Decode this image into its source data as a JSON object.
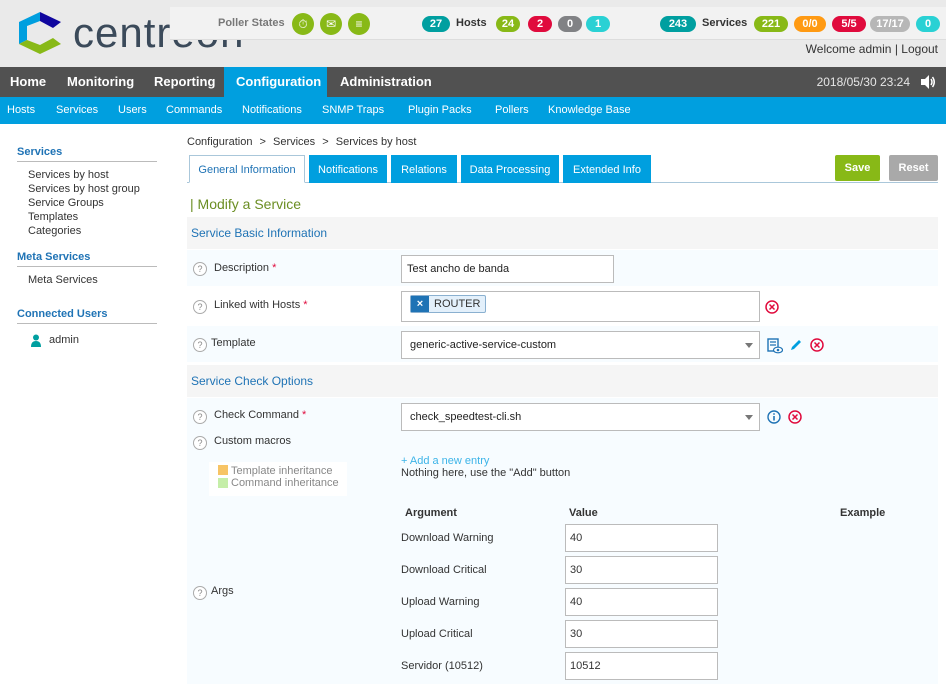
{
  "brand": {
    "name": "centreon"
  },
  "status": {
    "poller_states_label": "Poller States",
    "hosts": {
      "total": "27",
      "label": "Hosts",
      "up": "24",
      "down": "2",
      "unreachable": "0",
      "pending": "1"
    },
    "services": {
      "total": "243",
      "label": "Services",
      "ok": "221",
      "warning": "0/0",
      "critical": "5/5",
      "unknown": "17/17",
      "pending": "0"
    }
  },
  "user": {
    "welcome": "Welcome admin",
    "logout": "Logout",
    "separator": "|"
  },
  "mainnav": [
    "Home",
    "Monitoring",
    "Reporting",
    "Configuration",
    "Administration"
  ],
  "clock": "2018/05/30 23:24",
  "subnav": [
    "Hosts",
    "Services",
    "Users",
    "Commands",
    "Notifications",
    "SNMP Traps",
    "Plugin Packs",
    "Pollers",
    "Knowledge Base"
  ],
  "sidebar": {
    "services_title": "Services",
    "services_items": [
      "Services by host",
      "Services by host group",
      "Service Groups",
      "Templates",
      "Categories"
    ],
    "meta_title": "Meta Services",
    "meta_items": [
      "Meta Services"
    ],
    "users_title": "Connected Users",
    "users": [
      "admin"
    ]
  },
  "breadcrumb": [
    "Configuration",
    ">",
    "Services",
    ">",
    "Services by host"
  ],
  "tabs": [
    "General Information",
    "Notifications",
    "Relations",
    "Data Processing",
    "Extended Info"
  ],
  "buttons": {
    "save": "Save",
    "reset": "Reset"
  },
  "form": {
    "title": "| Modify a Service",
    "basic_section": "Service Basic Information",
    "description_label": "Description",
    "description_value": "Test ancho de banda",
    "linked_hosts_label": "Linked with Hosts",
    "linked_host": "ROUTER",
    "template_label": "Template",
    "template_value": "generic-active-service-custom",
    "check_section": "Service Check Options",
    "check_command_label": "Check Command",
    "check_command_value": "check_speedtest-cli.sh",
    "custom_macros_label": "Custom macros",
    "legend_template": "Template inheritance",
    "legend_command": "Command inheritance",
    "add_entry": "+ Add a new entry",
    "nothing_here": "Nothing here, use the \"Add\" button",
    "args_label": "Args",
    "required_mark": "*",
    "help_mark": "?",
    "args_headers": {
      "argument": "Argument",
      "value": "Value",
      "example": "Example"
    },
    "args": [
      {
        "name": "Download Warning",
        "value": "40"
      },
      {
        "name": "Download Critical",
        "value": "30"
      },
      {
        "name": "Upload Warning",
        "value": "40"
      },
      {
        "name": "Upload Critical",
        "value": "30"
      },
      {
        "name": "Servidor (10512)",
        "value": "10512"
      }
    ]
  },
  "colors": {
    "accent": "#009fdf",
    "ok": "#88b917",
    "critical": "#e00b3d",
    "warning": "#ff9a13",
    "teal": "#009fa0",
    "legend_template": "#f7c465",
    "legend_command": "#c5eea8"
  }
}
